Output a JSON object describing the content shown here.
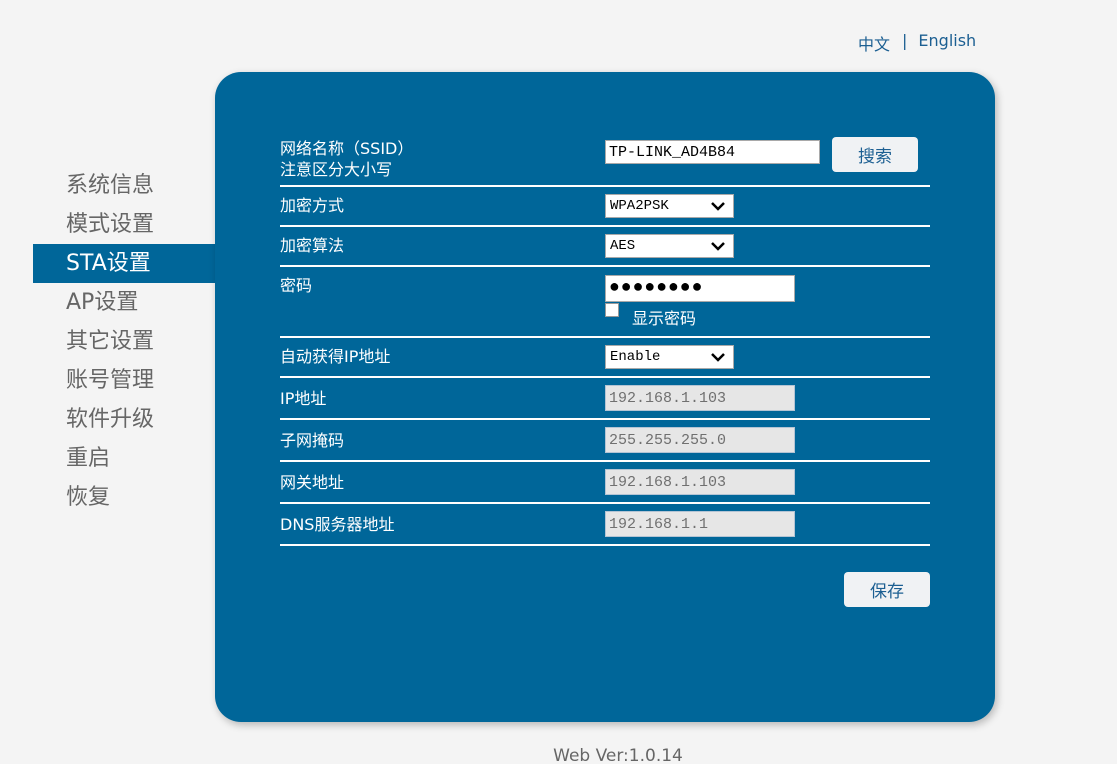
{
  "language": {
    "chinese": "中文",
    "separator": "|",
    "english": "English"
  },
  "sidebar": {
    "items": [
      {
        "label": "系统信息",
        "active": false
      },
      {
        "label": "模式设置",
        "active": false
      },
      {
        "label": "STA设置",
        "active": true
      },
      {
        "label": "AP设置",
        "active": false
      },
      {
        "label": "其它设置",
        "active": false
      },
      {
        "label": "账号管理",
        "active": false
      },
      {
        "label": "软件升级",
        "active": false
      },
      {
        "label": "重启",
        "active": false
      },
      {
        "label": "恢复",
        "active": false
      }
    ]
  },
  "form": {
    "ssid": {
      "label_line1": "网络名称（SSID）",
      "label_line2": "注意区分大小写",
      "value": "TP-LINK_AD4B84",
      "search_label": "搜索"
    },
    "encryption": {
      "label": "加密方式",
      "value": "WPA2PSK"
    },
    "algorithm": {
      "label": "加密算法",
      "value": "AES"
    },
    "password": {
      "label": "密码",
      "masked_value": "●●●●●●●●",
      "show_password_label": "显示密码",
      "show_password_checked": false
    },
    "dhcp": {
      "label": "自动获得IP地址",
      "value": "Enable"
    },
    "ip": {
      "label": "IP地址",
      "value": "192.168.1.103"
    },
    "mask": {
      "label": "子网掩码",
      "value": "255.255.255.0"
    },
    "gateway": {
      "label": "网关地址",
      "value": "192.168.1.103"
    },
    "dns": {
      "label": "DNS服务器地址",
      "value": "192.168.1.1"
    },
    "save_label": "保存"
  },
  "footer": {
    "version": "Web Ver:1.0.14"
  },
  "colors": {
    "primary": "#006699",
    "background": "#f4f4f4",
    "link": "#1c5f92"
  }
}
